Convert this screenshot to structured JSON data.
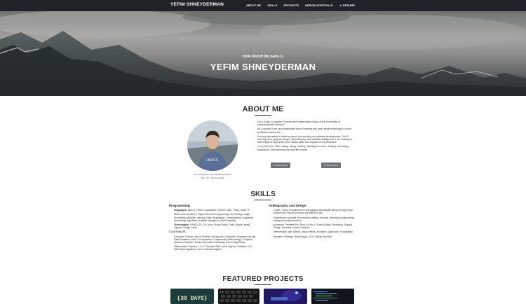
{
  "nav": {
    "brand": "YEFIM SHNEYDERMAN",
    "links": [
      "ABOUT ME",
      "SKILLS",
      "PROJECTS",
      "DESIGN PORTFOLIO",
      "▲ RESUME"
    ]
  },
  "hero": {
    "subtitle": "Hello World! My name is",
    "title": "YEFIM SHNEYDERMAN"
  },
  "about": {
    "heading": "ABOUT ME",
    "caption_1": "A morning hike in the Sandia Mountains",
    "caption_2": "Peru, 47 - Summer 2019",
    "paragraphs": [
      "I'm a Junior Computer Science and Mathematics Major at the University of Massachusetts Amherst.",
      "As a student I am very passionate about learning and love using technology to solve problems around me.",
      "I'm very interested in learning about and working on software development, UX/UI development, graphic design, cybersecurity, and artificial intelligence. I am looking for internships to help learn more useful skills and expand on my interests!",
      "In my free time I like coding, hiking, cycling, listening to music, reading, swimming, badminton, and watching my favorite movies."
    ],
    "button_1": "Portfolio Photo",
    "button_2": "Portfolio Photo"
  },
  "skills": {
    "heading": "SKILLS",
    "col1_title": "Programming",
    "col1": [
      {
        "label": "Languages:",
        "text": "Java, C, Python, JavaScript, Scheme, SQL, HTML, Kotlin, R"
      },
      {
        "label": "",
        "text": "Skills: Data Structures, Object-Oriented Programming, Unit Testing, Image Processing, Machine Learning, Data Visualization, Computational Complexity, Networking, Algorithms, Artificial Intelligence, Shell Scripting"
      },
      {
        "label": "Technologies:",
        "text": "HTML/CSS, Git, Linux, Visual Studio Code, Eclipse, IntelliJ, Jupyter, Google Colab"
      },
      {
        "label": "",
        "text": "Coursework:"
      },
      {
        "label": "",
        "text": "Computer Science: Intro to Problem Solving with Computers, Programming with Data Structures, Intro to Computation, Programming Methodology, Computer Systems Principles, Reasoning Under Uncertainty, Intro to Algorithms"
      },
      {
        "label": "",
        "text": "Mathematics: Calculus I, II, III, Discrete Math, Linear Algebra, Statistics I & II, Differential Equations, Intro to Abstract Algebra"
      }
    ],
    "col2_title": "Videography and Design",
    "col2": [
      {
        "label": "",
        "text": "I have 7 years of experience in videography and graphic design through team projects and my own personal commercial work."
      },
      {
        "label": "",
        "text": "Experience in all parts of production: editing, shooting, directing, storyboarding, writing and post-production."
      },
      {
        "label": "",
        "text": "Advanced: Premiere Pro, Final Cut Pro X, Video Editing, Photoshop, Graphic Design, Illustrator, Motion Graphics"
      },
      {
        "label": "",
        "text": "Intermediate: After Effects, Visual Effects, Animation, Lightroom, Photography"
      },
      {
        "label": "",
        "text": "Beginner: InDesign, Web Design, UX/UI Design, Audition"
      }
    ]
  },
  "projects": {
    "heading": "FEATURED PROJECTS",
    "tile_1_text": "{30 DAYS}"
  }
}
